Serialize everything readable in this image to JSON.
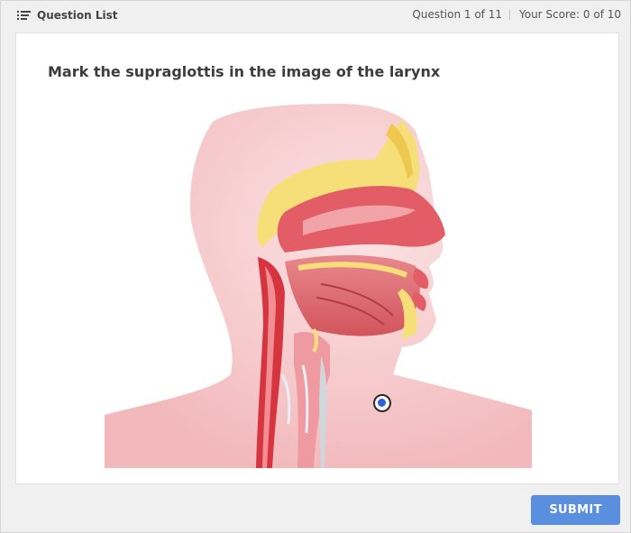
{
  "header": {
    "question_list_label": "Question List",
    "question_progress": "Question 1 of 11",
    "score": "Your Score: 0 of 10"
  },
  "question": {
    "prompt": "Mark the supraglottis in the image of the larynx"
  },
  "image": {
    "alt": "Sagittal cross-section of the head and neck showing the larynx"
  },
  "actions": {
    "submit_label": "SUBMIT"
  },
  "colors": {
    "submit": "#5a8fe0",
    "marker_dot": "#2d63d9",
    "tissue_pink": "#f2b3b6",
    "tissue_red": "#d8404b",
    "bone_yellow": "#f7e27c"
  }
}
